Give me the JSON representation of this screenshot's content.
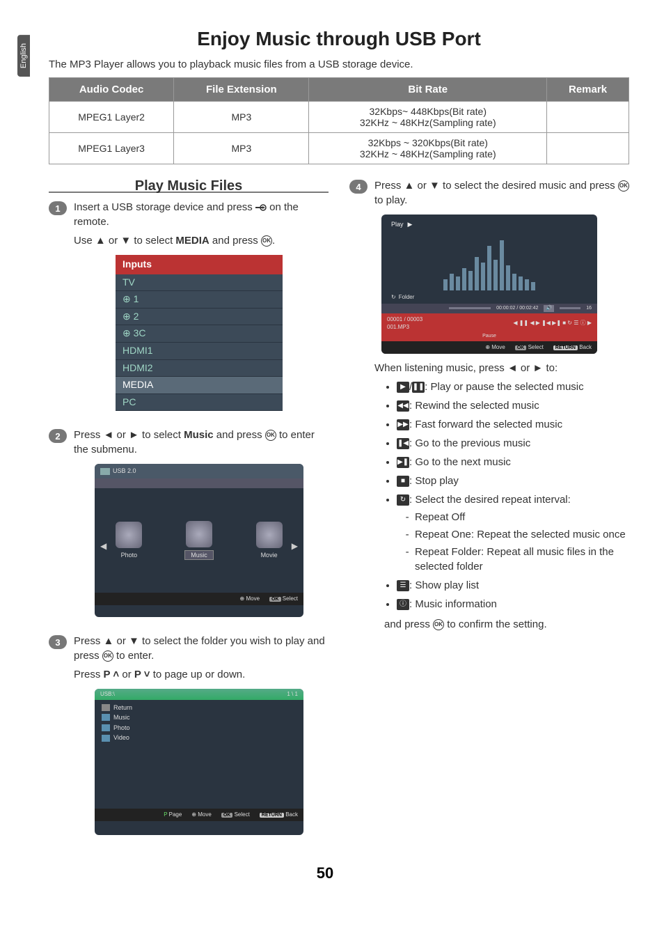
{
  "lang": "English",
  "title": "Enjoy Music through USB Port",
  "intro": "The MP3 Player allows you to playback music files from a USB storage device.",
  "table": {
    "headers": [
      "Audio Codec",
      "File Extension",
      "Bit Rate",
      "Remark"
    ],
    "rows": [
      {
        "codec": "MPEG1 Layer2",
        "ext": "MP3",
        "rate_line1": "32Kbps~ 448Kbps(Bit rate)",
        "rate_line2": "32KHz ~ 48KHz(Sampling rate)",
        "remark": ""
      },
      {
        "codec": "MPEG1 Layer3",
        "ext": "MP3",
        "rate_line1": "32Kbps ~ 320Kbps(Bit rate)",
        "rate_line2": "32KHz ~ 48KHz(Sampling rate)",
        "remark": ""
      }
    ]
  },
  "section_title": "Play Music Files",
  "steps": {
    "s1a_pre": "Insert a USB storage device and  press ",
    "s1a_post": " on the remote.",
    "s1b_pre": "Use ▲ or ▼  to select ",
    "s1b_bold": "MEDIA",
    "s1b_post": " and press ",
    "s1b_end": ".",
    "s2_pre": "Press ◄ or ►  to select ",
    "s2_bold": "Music",
    "s2_post": " and press ",
    "s2_end": " to enter the submenu.",
    "s3a_pre": "Press ▲ or ▼ to select the folder you wish to play and press ",
    "s3a_post": " to enter.",
    "s3b_pre": "Press ",
    "s3b_b1": "P ",
    "s3b_up": "˄",
    "s3b_or": " or ",
    "s3b_b2": "P ",
    "s3b_dn": "˅",
    "s3b_post": " to page up or down.",
    "s4_pre": "Press ▲ or ▼ to select the desired music and press ",
    "s4_post": " to play."
  },
  "inputs_menu": {
    "header": "Inputs",
    "items": [
      "TV",
      "1",
      "2",
      "3C",
      "HDMI1",
      "HDMI2",
      "MEDIA",
      "PC"
    ]
  },
  "browse": {
    "usb": "USB 2.0",
    "tiles": [
      "Photo",
      "Music",
      "Movie"
    ],
    "footer_move": "Move",
    "footer_select": "Select"
  },
  "folder": {
    "path": "USB:\\",
    "page": "1 \\ 1",
    "items": [
      "Return",
      "Music",
      "Photo",
      "Video"
    ],
    "footer_page": "Page",
    "footer_move": "Move",
    "footer_select": "Select",
    "footer_back": "Back"
  },
  "player": {
    "play": "Play",
    "folder": "Folder",
    "time": "00:00:02 / 00:02:42",
    "vol": "16",
    "count": "00001 / 00003",
    "file": "001.MP3",
    "pause": "Pause",
    "footer_move": "Move",
    "footer_select": "Select",
    "footer_back": "Back"
  },
  "actions": {
    "intro": "When listening music, press ◄ or ► to:",
    "play_pause": ": Play or pause the selected music",
    "rewind": ": Rewind the selected music",
    "ff": ": Fast forward the selected music",
    "prev": ": Go to the previous music",
    "next": ": Go to the next music",
    "stop": ": Stop play",
    "repeat": ": Select the desired repeat interval:",
    "repeat_off": "Repeat Off",
    "repeat_one": "Repeat One: Repeat the selected music once",
    "repeat_folder": "Repeat Folder: Repeat all music files in the selected folder",
    "playlist": ": Show play list",
    "info": ": Music information",
    "confirm_pre": "and press ",
    "confirm_post": " to confirm the setting."
  },
  "ok_label": "OK",
  "return_label": "RETURN",
  "pagenum": "50"
}
